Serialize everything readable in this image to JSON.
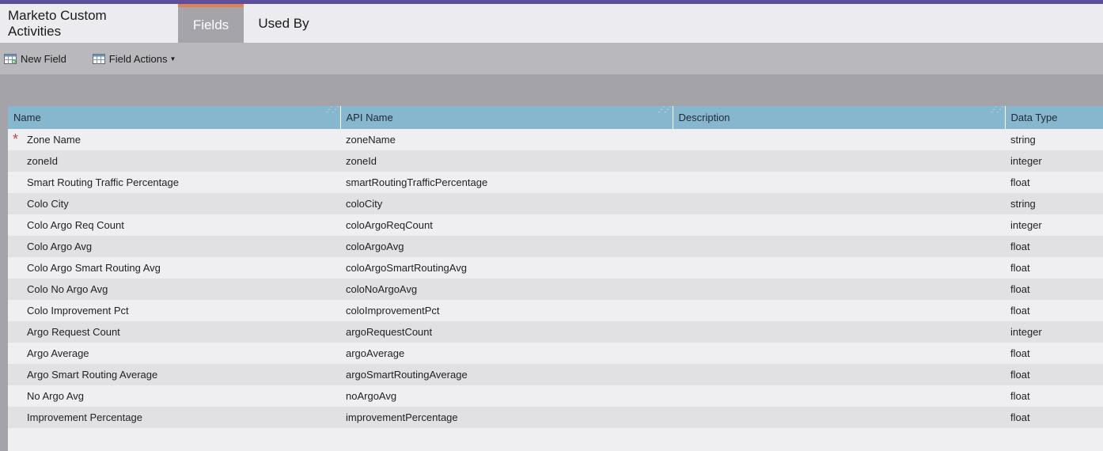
{
  "app": {
    "title": "Marketo Custom Activities",
    "tabs": [
      {
        "label": "Fields",
        "active": true
      },
      {
        "label": "Used By",
        "active": false
      }
    ],
    "accent_color": "#5b4f9e",
    "active_tab_color": "#e0814f"
  },
  "toolbar": {
    "new_field_label": "New Field",
    "field_actions_label": "Field Actions"
  },
  "table": {
    "columns": [
      "Name",
      "API Name",
      "Description",
      "Data Type"
    ],
    "rows": [
      {
        "name": "Zone Name",
        "api": "zoneName",
        "description": "",
        "type": "string",
        "required": true
      },
      {
        "name": "zoneId",
        "api": "zoneId",
        "description": "",
        "type": "integer",
        "required": false
      },
      {
        "name": "Smart Routing Traffic Percentage",
        "api": "smartRoutingTrafficPercentage",
        "description": "",
        "type": "float",
        "required": false
      },
      {
        "name": "Colo City",
        "api": "coloCity",
        "description": "",
        "type": "string",
        "required": false
      },
      {
        "name": "Colo Argo Req Count",
        "api": "coloArgoReqCount",
        "description": "",
        "type": "integer",
        "required": false
      },
      {
        "name": "Colo Argo Avg",
        "api": "coloArgoAvg",
        "description": "",
        "type": "float",
        "required": false
      },
      {
        "name": "Colo Argo Smart Routing Avg",
        "api": "coloArgoSmartRoutingAvg",
        "description": "",
        "type": "float",
        "required": false
      },
      {
        "name": "Colo No Argo Avg",
        "api": "coloNoArgoAvg",
        "description": "",
        "type": "float",
        "required": false
      },
      {
        "name": "Colo Improvement Pct",
        "api": "coloImprovementPct",
        "description": "",
        "type": "float",
        "required": false
      },
      {
        "name": "Argo Request Count",
        "api": "argoRequestCount",
        "description": "",
        "type": "integer",
        "required": false
      },
      {
        "name": "Argo Average",
        "api": "argoAverage",
        "description": "",
        "type": "float",
        "required": false
      },
      {
        "name": "Argo Smart Routing Average",
        "api": "argoSmartRoutingAverage",
        "description": "",
        "type": "float",
        "required": false
      },
      {
        "name": "No Argo Avg",
        "api": "noArgoAvg",
        "description": "",
        "type": "float",
        "required": false
      },
      {
        "name": "Improvement Percentage",
        "api": "improvementPercentage",
        "description": "",
        "type": "float",
        "required": false
      }
    ]
  },
  "icons": {
    "new_field": "grid-add-icon",
    "field_actions": "grid-icon",
    "required_marker": "asterisk-icon",
    "column_grip": "resize-grip-icon",
    "dropdown": "caret-down-icon"
  }
}
